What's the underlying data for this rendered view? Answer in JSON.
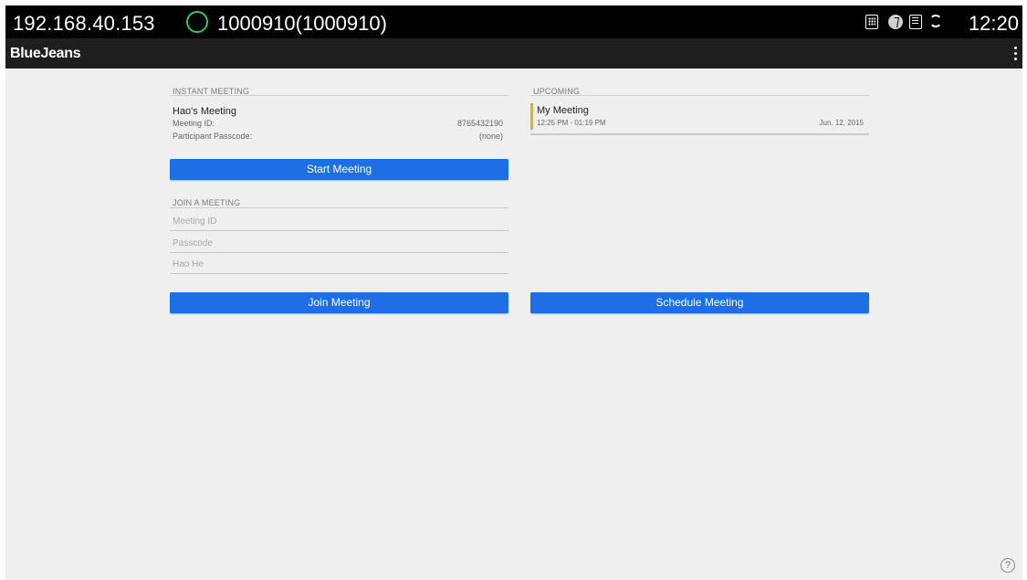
{
  "status_bar": {
    "ip": "192.168.40.153",
    "account": "1000910(1000910)",
    "time": "12:20",
    "icons": [
      "account-icon",
      "dialpad-icon",
      "bluetooth-icon",
      "sim-icon",
      "sync-icon"
    ]
  },
  "app_bar": {
    "title": "BlueJeans",
    "menu_icon": "overflow-menu-icon"
  },
  "instant_meeting": {
    "section_label": "INSTANT MEETING",
    "meeting_name": "Hao's Meeting",
    "meeting_id_label": "Meeting ID:",
    "meeting_id_value": "8765432190",
    "passcode_label": "Participant Passcode:",
    "passcode_value": "(none)",
    "start_button": "Start Meeting"
  },
  "join_meeting": {
    "section_label": "JOIN A MEETING",
    "meeting_id_placeholder": "Meeting ID",
    "passcode_placeholder": "Passcode",
    "name_placeholder": "Hao He",
    "join_button": "Join Meeting"
  },
  "upcoming": {
    "section_label": "UPCOMING",
    "items": [
      {
        "title": "My Meeting",
        "time": "12:25 PM - 01:19 PM",
        "date": "Jun. 12, 2015"
      }
    ],
    "schedule_button": "Schedule Meeting"
  },
  "help_icon": "?",
  "colors": {
    "primary_button": "#1e6fe6",
    "accent": "#f5a623",
    "status_bar": "#000000",
    "app_bar": "#1e1e1e",
    "background": "#efefef",
    "account_icon": "#34c759"
  }
}
